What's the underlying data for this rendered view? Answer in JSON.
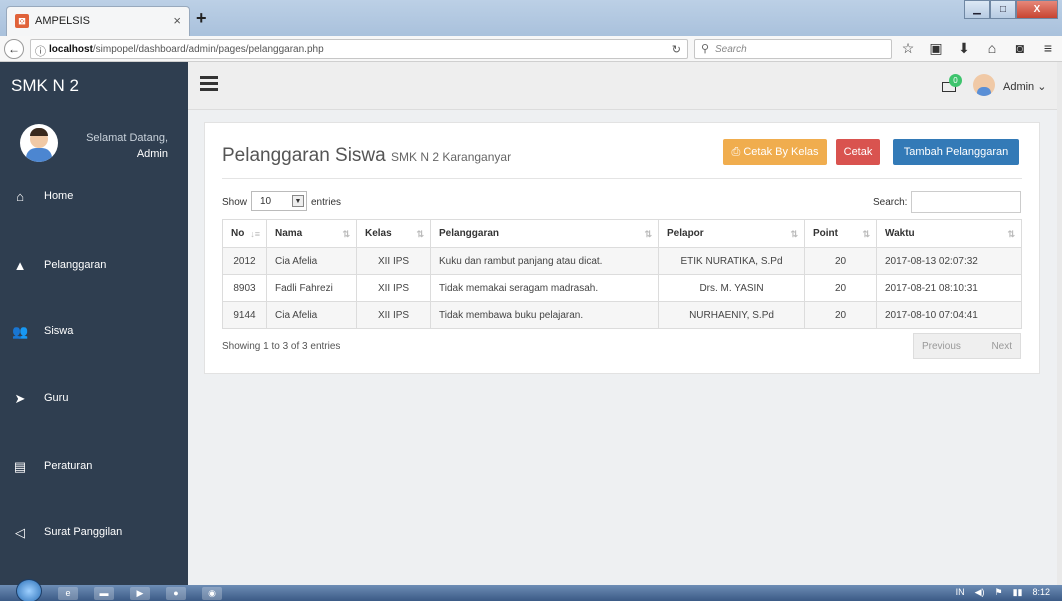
{
  "browser": {
    "tab_title": "AMPELSIS",
    "tab_favicon": "⊠",
    "tab_close": "×",
    "new_tab": "+",
    "url_host": "localhost",
    "url_path": "/simpopel/dashboard/admin/pages/pelanggaran.php",
    "search_placeholder": "Search",
    "window_buttons": [
      "▁",
      "□",
      "X"
    ]
  },
  "app": {
    "brand": "SMK N 2",
    "top_user": "Admin ⌄",
    "notif_count": "0"
  },
  "sidebar": {
    "welcome": "Selamat Datang,",
    "name": "Admin",
    "items": [
      {
        "label": "Home",
        "icon": "⌂"
      },
      {
        "label": "Pelanggaran",
        "icon": "▲"
      },
      {
        "label": "Siswa",
        "icon": "👥"
      },
      {
        "label": "Guru",
        "icon": "➤"
      },
      {
        "label": "Peraturan",
        "icon": "▤"
      },
      {
        "label": "Surat Panggilan",
        "icon": "◁"
      }
    ]
  },
  "page": {
    "title": "Pelanggaran Siswa",
    "subtitle": "SMK N 2 Karanganyar",
    "btn_cetak_kelas": "Cetak By Kelas",
    "btn_cetak": "Cetak",
    "btn_tambah": "Tambah Pelanggaran",
    "show_label": "Show",
    "show_value": "10",
    "entries_label": "entries",
    "search_label": "Search:",
    "showing": "Showing 1 to 3 of 3 entries",
    "prev": "Previous",
    "next": "Next"
  },
  "table": {
    "headers": [
      "No",
      "Nama",
      "Kelas",
      "Pelanggaran",
      "Pelapor",
      "Point",
      "Waktu"
    ],
    "rows": [
      [
        "2012",
        "Cia Afelia",
        "XII IPS",
        "Kuku dan rambut panjang atau dicat.",
        "ETIK NURATIKA, S.Pd",
        "20",
        "2017-08-13 02:07:32"
      ],
      [
        "8903",
        "Fadli Fahrezi",
        "XII IPS",
        "Tidak memakai seragam madrasah.",
        "Drs. M. YASIN",
        "20",
        "2017-08-21 08:10:31"
      ],
      [
        "9144",
        "Cia Afelia",
        "XII IPS",
        "Tidak membawa buku pelajaran.",
        "NURHAENIY, S.Pd",
        "20",
        "2017-08-10 07:04:41"
      ]
    ]
  },
  "taskbar": {
    "lang": "IN",
    "time": "8:12"
  }
}
